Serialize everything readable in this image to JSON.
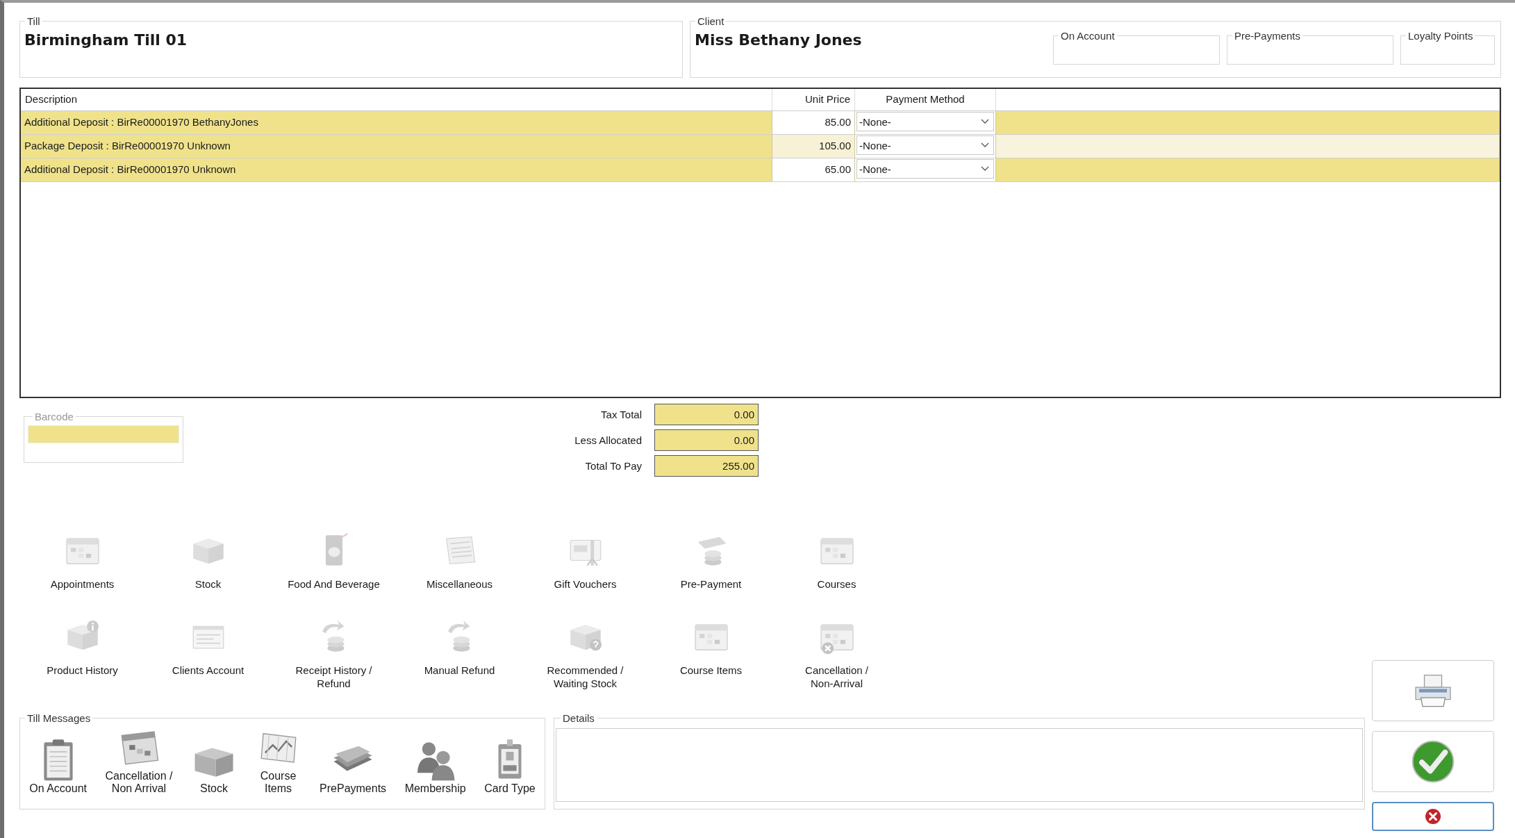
{
  "till": {
    "label": "Till",
    "value": "Birmingham Till 01"
  },
  "client": {
    "label": "Client",
    "name": "Miss Bethany Jones",
    "balances": [
      {
        "label": "On Account"
      },
      {
        "label": "Pre-Payments"
      },
      {
        "label": "Loyalty Points"
      }
    ]
  },
  "table": {
    "columns": [
      "Description",
      "Unit Price",
      "Payment Method"
    ],
    "rows": [
      {
        "description": "Additional Deposit :  BirRe00001970 BethanyJones",
        "unit_price": "85.00",
        "payment_method": "-None-",
        "selected": false
      },
      {
        "description": "Package Deposit :  BirRe00001970 Unknown",
        "unit_price": "105.00",
        "payment_method": "-None-",
        "selected": true
      },
      {
        "description": "Additional Deposit :  BirRe00001970 Unknown",
        "unit_price": "65.00",
        "payment_method": "-None-",
        "selected": false
      }
    ]
  },
  "barcode": {
    "label": "Barcode"
  },
  "totals": [
    {
      "label": "Tax Total",
      "value": "0.00"
    },
    {
      "label": "Less Allocated",
      "value": "0.00"
    },
    {
      "label": "Total To Pay",
      "value": "255.00"
    }
  ],
  "actions": [
    "Appointments",
    "Stock",
    "Food And Beverage",
    "Miscellaneous",
    "Gift Vouchers",
    "Pre-Payment",
    "Courses",
    "Product History",
    "Clients Account",
    "Receipt History /\nRefund",
    "Manual Refund",
    "Recommended /\nWaiting Stock",
    "Course Items",
    "Cancellation /\nNon-Arrival"
  ],
  "till_messages": {
    "label": "Till Messages",
    "items": [
      "On Account",
      "Cancellation /\nNon Arrival",
      "Stock",
      "Course\nItems",
      "PrePayments",
      "Membership",
      "Card Type"
    ]
  },
  "details": {
    "label": "Details"
  }
}
